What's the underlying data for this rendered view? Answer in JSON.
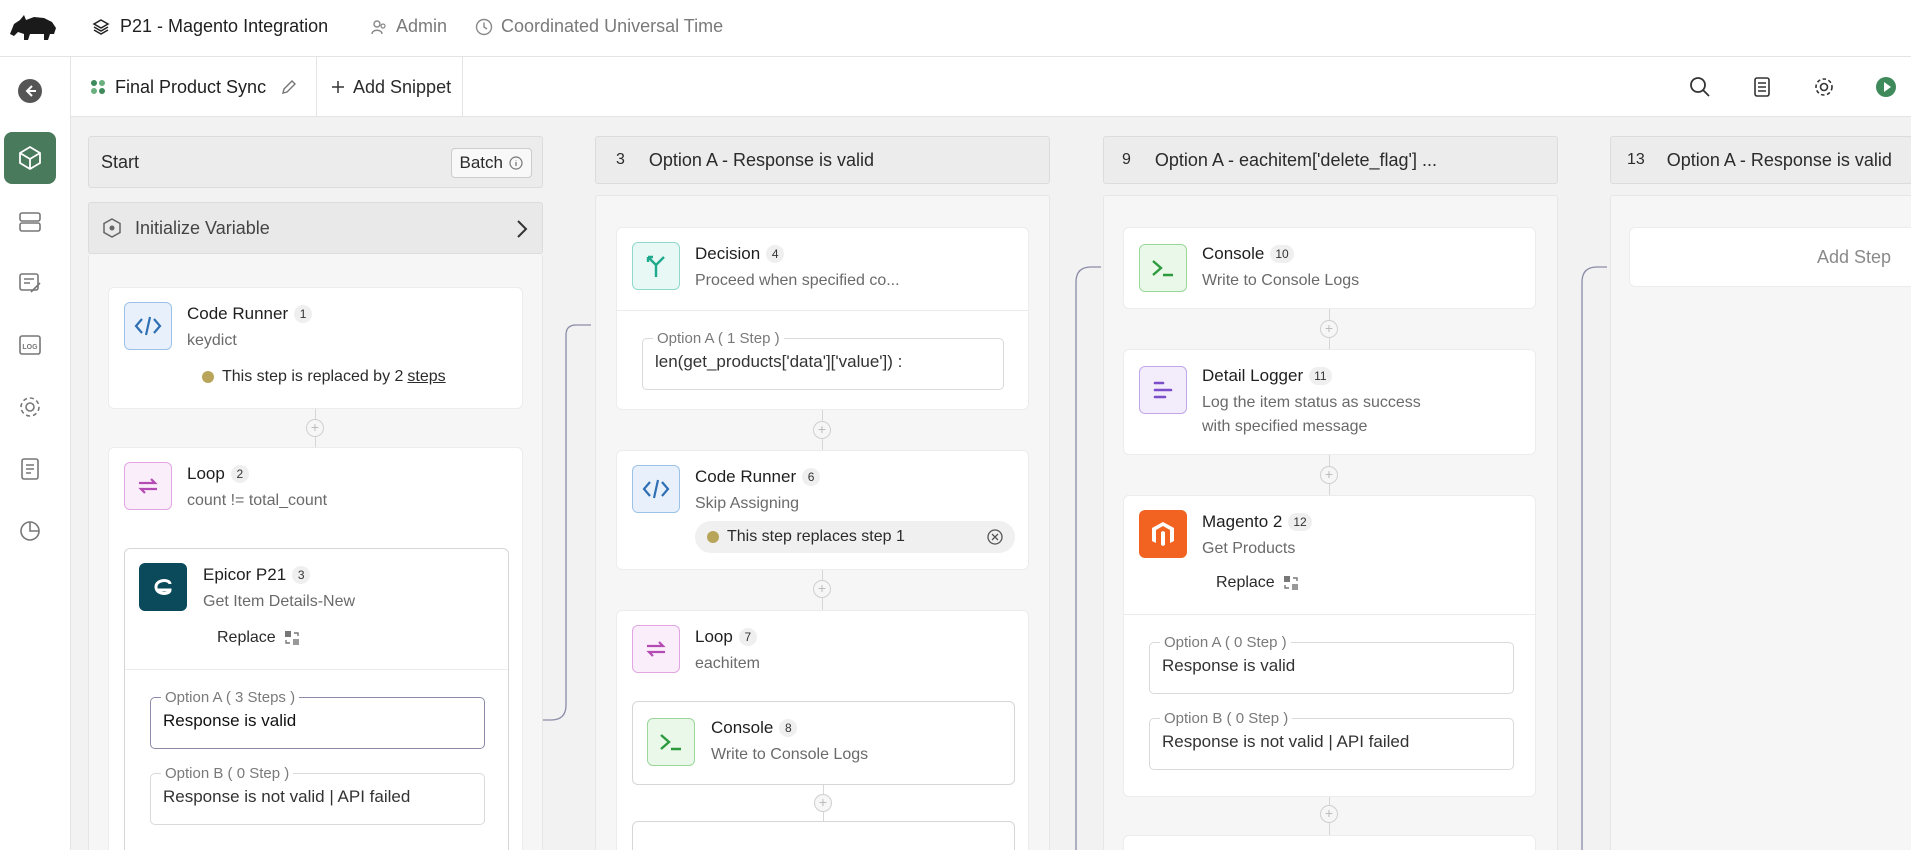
{
  "header": {
    "project": "P21 - Magento Integration",
    "user": "Admin",
    "timezone": "Coordinated Universal Time"
  },
  "tabs": {
    "flow_name": "Final Product Sync",
    "add_snippet": "Add Snippet"
  },
  "columns": {
    "start": {
      "title": "Start",
      "mode": "Batch",
      "init_label": "Initialize Variable",
      "code_runner": {
        "title": "Code Runner",
        "num": "1",
        "sub": "keydict",
        "note_prefix": "This step is replaced by 2",
        "note_link": "steps"
      },
      "loop": {
        "title": "Loop",
        "num": "2",
        "sub": "count != total_count"
      },
      "epicor": {
        "title": "Epicor P21",
        "num": "3",
        "sub": "Get Item Details-New",
        "replace": "Replace"
      },
      "option_a": {
        "label": "Option A ( 3 Steps )",
        "value": "Response is valid"
      },
      "option_b": {
        "label": "Option B ( 0 Step )",
        "value": "Response is not valid | API failed"
      }
    },
    "col3": {
      "num": "3",
      "title": "Option A - Response is valid",
      "decision": {
        "title": "Decision",
        "num": "4",
        "sub": "Proceed when specified co..."
      },
      "decision_opt": {
        "label": "Option A ( 1 Step )",
        "value": "len(get_products['data']['value']) :"
      },
      "code_runner": {
        "title": "Code Runner",
        "num": "6",
        "sub": "Skip Assigning",
        "note": "This step replaces step 1"
      },
      "loop": {
        "title": "Loop",
        "num": "7",
        "sub": "eachitem"
      },
      "console": {
        "title": "Console",
        "num": "8",
        "sub": "Write to Console Logs"
      }
    },
    "col9": {
      "num": "9",
      "title": "Option A - eachitem['delete_flag'] ...",
      "console": {
        "title": "Console",
        "num": "10",
        "sub": "Write to Console Logs"
      },
      "logger": {
        "title": "Detail Logger",
        "num": "11",
        "sub1": "Log the item status as success",
        "sub2": "with specified message"
      },
      "magento": {
        "title": "Magento 2",
        "num": "12",
        "sub": "Get Products",
        "replace": "Replace"
      },
      "option_a": {
        "label": "Option A ( 0 Step )",
        "value": "Response is valid"
      },
      "option_b": {
        "label": "Option B ( 0 Step )",
        "value": "Response is not valid | API failed"
      }
    },
    "col13": {
      "num": "13",
      "title": "Option A - Response is valid",
      "add_step": "Add Step"
    }
  },
  "colors": {
    "accent_green": "#4a7a5c",
    "magento_orange": "#f26322",
    "epicor_teal": "#0b4a5a"
  }
}
